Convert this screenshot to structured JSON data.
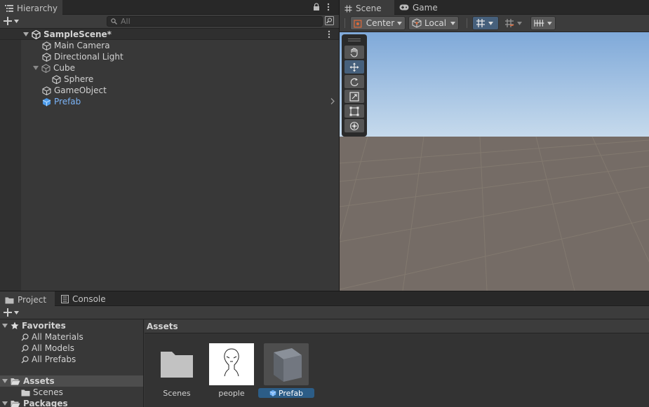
{
  "hierarchy": {
    "tab": "Hierarchy",
    "search_placeholder": "All",
    "scene": "SampleScene*",
    "items": [
      {
        "label": "Main Camera"
      },
      {
        "label": "Directional Light"
      },
      {
        "label": "Cube"
      },
      {
        "label": "Sphere"
      },
      {
        "label": "GameObject"
      },
      {
        "label": "Prefab"
      }
    ]
  },
  "scene_view": {
    "tabs": [
      {
        "label": "Scene"
      },
      {
        "label": "Game"
      }
    ],
    "pivot": "Center",
    "space": "Local"
  },
  "project": {
    "tabs": [
      {
        "label": "Project"
      },
      {
        "label": "Console"
      }
    ],
    "favorites": {
      "label": "Favorites",
      "items": [
        {
          "label": "All Materials"
        },
        {
          "label": "All Models"
        },
        {
          "label": "All Prefabs"
        }
      ]
    },
    "assets_root": "Assets",
    "assets_children": [
      {
        "label": "Scenes"
      }
    ],
    "packages": "Packages",
    "breadcrumb": "Assets",
    "grid": [
      {
        "label": "Scenes"
      },
      {
        "label": "people"
      },
      {
        "label": "Prefab"
      }
    ]
  },
  "colors": {
    "accent": "#3a79bb",
    "prefab_text": "#7cb4f7",
    "selection": "#2c5d87"
  }
}
